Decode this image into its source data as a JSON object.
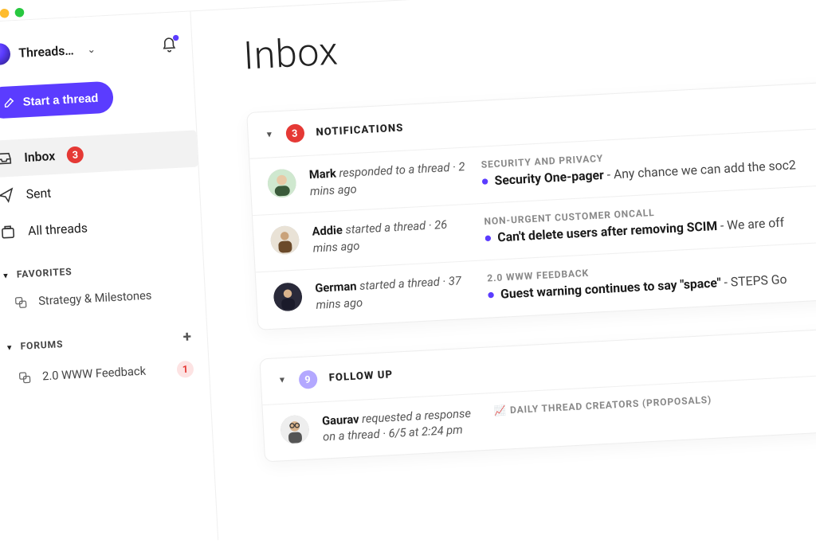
{
  "workspace": {
    "name": "Threads…"
  },
  "sidebar": {
    "start_label": "Start a thread",
    "nav": {
      "inbox": {
        "label": "Inbox",
        "badge": "3"
      },
      "sent": {
        "label": "Sent"
      },
      "all": {
        "label": "All threads"
      }
    },
    "favorites": {
      "header": "FAVORITES",
      "items": [
        {
          "label": "Strategy & Milestones"
        }
      ]
    },
    "forums": {
      "header": "FORUMS",
      "items": [
        {
          "label": "2.0 WWW Feedback",
          "badge": "1"
        }
      ]
    }
  },
  "main": {
    "title": "Inbox",
    "groups": [
      {
        "id": "notifications",
        "count": "3",
        "count_style": "red",
        "label": "NOTIFICATIONS",
        "items": [
          {
            "actor": "Mark",
            "action": "responded to a thread",
            "time": "2 mins ago",
            "channel": "SECURITY AND PRIVACY",
            "subject": "Security One-pager",
            "preview": "Any chance we can add the soc2",
            "avatar": "mark"
          },
          {
            "actor": "Addie",
            "action": "started a thread",
            "time": "26 mins ago",
            "channel": "NON-URGENT CUSTOMER ONCALL",
            "subject": "Can't delete users after removing SCIM",
            "preview": "We are off",
            "avatar": "addie"
          },
          {
            "actor": "German",
            "action": "started a thread",
            "time": "37 mins ago",
            "channel": "2.0 WWW FEEDBACK",
            "subject": "Guest warning continues to say \"space\"",
            "preview": "STEPS Go",
            "avatar": "german"
          }
        ]
      },
      {
        "id": "followup",
        "count": "9",
        "count_style": "purple",
        "label": "FOLLOW UP",
        "items": [
          {
            "actor": "Gaurav",
            "action": "requested a response on a thread",
            "time": "6/5 at 2:24 pm",
            "channel": "DAILY THREAD CREATORS (PROPOSALS)",
            "channel_emoji": "📈",
            "subject": "",
            "preview": "",
            "avatar": "gaurav"
          }
        ]
      }
    ]
  }
}
